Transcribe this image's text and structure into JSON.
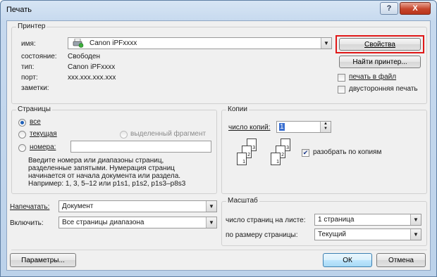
{
  "window": {
    "title": "Печать",
    "help_label": "?",
    "close_label": "X"
  },
  "printer": {
    "legend": "Принтер",
    "name_label": "имя:",
    "name_value": "Canon iPFxxxx",
    "status_label": "состояние:",
    "status_value": "Свободен",
    "type_label": "тип:",
    "type_value": "Canon iPFxxxx",
    "port_label": "порт:",
    "port_value": "xxx.xxx.xxx.xxx",
    "notes_label": "заметки:",
    "properties_button": "Свойства",
    "find_printer_button": "Найти принтер...",
    "print_to_file_label": "печать в файл",
    "print_to_file_checked": false,
    "duplex_label": "двусторонняя печать",
    "duplex_checked": false
  },
  "pages": {
    "legend": "Страницы",
    "all_label": "все",
    "current_label": "текущая",
    "selection_label": "выделенный фрагмент",
    "numbers_label": "номера:",
    "numbers_value": "",
    "selected": "all",
    "hint_lines": [
      "Введите номера или диапазоны страниц,",
      "разделенные запятыми. Нумерация страниц",
      "начинается от начала документа или раздела.",
      "Например: 1, 3, 5–12 или p1s1, p1s2, p1s3–p8s3"
    ]
  },
  "copies": {
    "legend": "Копии",
    "count_label": "число копий:",
    "count_value": "1",
    "collate_label": "разобрать по копиям",
    "collate_checked": true,
    "page_numbers": [
      "1",
      "2",
      "3"
    ]
  },
  "print_what": {
    "label": "Напечатать:",
    "value": "Документ"
  },
  "include": {
    "label": "Включить:",
    "value": "Все страницы диапазона"
  },
  "zoom": {
    "legend": "Масштаб",
    "pages_per_sheet_label": "число страниц на листе:",
    "pages_per_sheet_value": "1 страница",
    "scale_label": "по размеру страницы:",
    "scale_value": "Текущий"
  },
  "footer": {
    "options_button": "Параметры...",
    "ok_button": "ОК",
    "cancel_button": "Отмена"
  },
  "colors": {
    "highlight": "#e01818"
  }
}
